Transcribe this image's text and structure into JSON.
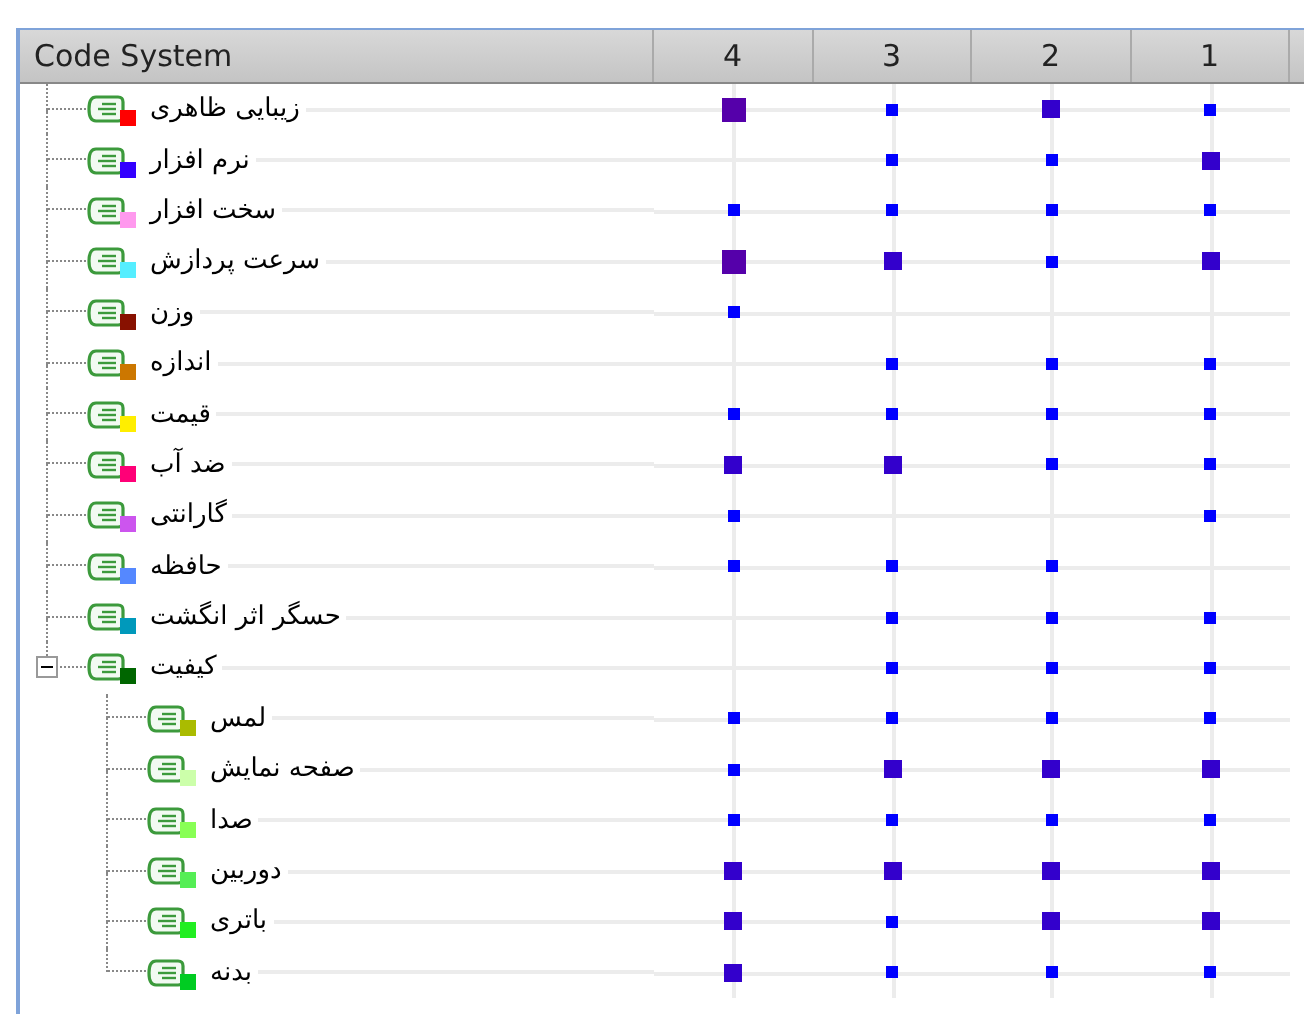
{
  "header": {
    "title": "Code System",
    "columns": [
      "1",
      "2",
      "3",
      "4"
    ]
  },
  "codes": [
    {
      "name": "زیبایی ظاهری",
      "color": "#ff0000",
      "cells": [
        {
          "kind": "small"
        },
        {
          "kind": "medium"
        },
        {
          "kind": "small"
        },
        {
          "kind": "large"
        }
      ]
    },
    {
      "name": "نرم افزار",
      "color": "#3300ff",
      "cells": [
        {
          "kind": "medium"
        },
        {
          "kind": "small"
        },
        {
          "kind": "small"
        },
        {
          "kind": "none"
        }
      ]
    },
    {
      "name": "سخت افزار",
      "color": "#ff99ee",
      "cells": [
        {
          "kind": "small"
        },
        {
          "kind": "small"
        },
        {
          "kind": "small"
        },
        {
          "kind": "small"
        }
      ]
    },
    {
      "name": "سرعت پردازش",
      "color": "#55eeff",
      "cells": [
        {
          "kind": "medium"
        },
        {
          "kind": "small"
        },
        {
          "kind": "medium"
        },
        {
          "kind": "large"
        }
      ]
    },
    {
      "name": "وزن",
      "color": "#881100",
      "cells": [
        {
          "kind": "none"
        },
        {
          "kind": "none"
        },
        {
          "kind": "none"
        },
        {
          "kind": "small"
        }
      ]
    },
    {
      "name": "اندازه",
      "color": "#cc7700",
      "cells": [
        {
          "kind": "small"
        },
        {
          "kind": "small"
        },
        {
          "kind": "small"
        },
        {
          "kind": "none"
        }
      ]
    },
    {
      "name": "قیمت",
      "color": "#ffee00",
      "cells": [
        {
          "kind": "small"
        },
        {
          "kind": "small"
        },
        {
          "kind": "small"
        },
        {
          "kind": "small"
        }
      ]
    },
    {
      "name": "ضد آب",
      "color": "#ff0077",
      "cells": [
        {
          "kind": "small"
        },
        {
          "kind": "small"
        },
        {
          "kind": "medium"
        },
        {
          "kind": "medium"
        }
      ]
    },
    {
      "name": "گارانتی",
      "color": "#cc55ee",
      "cells": [
        {
          "kind": "small"
        },
        {
          "kind": "none"
        },
        {
          "kind": "none"
        },
        {
          "kind": "small"
        }
      ]
    },
    {
      "name": "حافظه",
      "color": "#5588ff",
      "cells": [
        {
          "kind": "none"
        },
        {
          "kind": "small"
        },
        {
          "kind": "small"
        },
        {
          "kind": "small"
        }
      ]
    },
    {
      "name": "حسگر اثر انگشت",
      "color": "#0099bb",
      "cells": [
        {
          "kind": "small"
        },
        {
          "kind": "small"
        },
        {
          "kind": "small"
        },
        {
          "kind": "none"
        }
      ]
    },
    {
      "name": "کیفیت",
      "color": "#006600",
      "expanded": true,
      "cells": [
        {
          "kind": "small"
        },
        {
          "kind": "small"
        },
        {
          "kind": "small"
        },
        {
          "kind": "none"
        }
      ],
      "children": [
        {
          "name": "لمس",
          "color": "#aabb00",
          "cells": [
            {
              "kind": "small"
            },
            {
              "kind": "small"
            },
            {
              "kind": "small"
            },
            {
              "kind": "small"
            }
          ]
        },
        {
          "name": "صفحه نمایش",
          "color": "#ccffaa",
          "cells": [
            {
              "kind": "medium"
            },
            {
              "kind": "medium"
            },
            {
              "kind": "medium"
            },
            {
              "kind": "small"
            }
          ]
        },
        {
          "name": "صدا",
          "color": "#88ff55",
          "cells": [
            {
              "kind": "small"
            },
            {
              "kind": "small"
            },
            {
              "kind": "small"
            },
            {
              "kind": "small"
            }
          ]
        },
        {
          "name": "دوربین",
          "color": "#55ee55",
          "cells": [
            {
              "kind": "medium"
            },
            {
              "kind": "medium"
            },
            {
              "kind": "medium"
            },
            {
              "kind": "medium"
            }
          ]
        },
        {
          "name": "باتری",
          "color": "#22ee22",
          "cells": [
            {
              "kind": "medium"
            },
            {
              "kind": "medium"
            },
            {
              "kind": "small"
            },
            {
              "kind": "medium"
            }
          ]
        },
        {
          "name": "بدنه",
          "color": "#00cc22",
          "cells": [
            {
              "kind": "small"
            },
            {
              "kind": "small"
            },
            {
              "kind": "small"
            },
            {
              "kind": "medium"
            }
          ]
        }
      ]
    }
  ]
}
